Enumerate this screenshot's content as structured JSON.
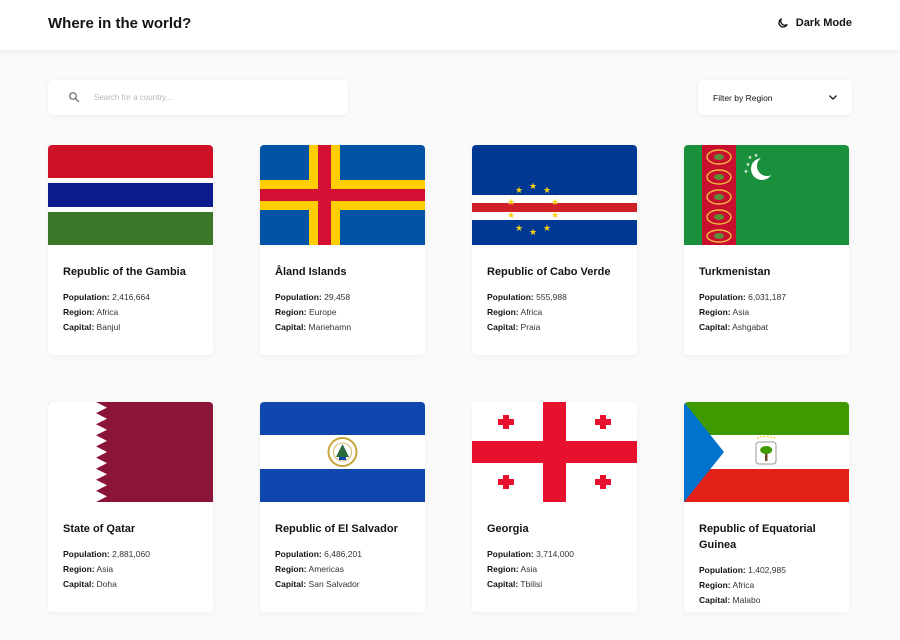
{
  "header": {
    "title": "Where in the world?",
    "theme_toggle_label": "Dark Mode"
  },
  "search": {
    "placeholder": "Search for a country...",
    "value": ""
  },
  "filter": {
    "label": "Filter by Region"
  },
  "field_labels": {
    "population": "Population:",
    "region": "Region:",
    "capital": "Capital:"
  },
  "countries": [
    {
      "name": "Republic of the Gambia",
      "population": "2,416,664",
      "region": "Africa",
      "capital": "Banjul"
    },
    {
      "name": "Åland Islands",
      "population": "29,458",
      "region": "Europe",
      "capital": "Mariehamn"
    },
    {
      "name": "Republic of Cabo Verde",
      "population": "555,988",
      "region": "Africa",
      "capital": "Praia"
    },
    {
      "name": "Turkmenistan",
      "population": "6,031,187",
      "region": "Asia",
      "capital": "Ashgabat"
    },
    {
      "name": "State of Qatar",
      "population": "2,881,060",
      "region": "Asia",
      "capital": "Doha"
    },
    {
      "name": "Republic of El Salvador",
      "population": "6,486,201",
      "region": "Americas",
      "capital": "San Salvador"
    },
    {
      "name": "Georgia",
      "population": "3,714,000",
      "region": "Asia",
      "capital": "Tbilisi"
    },
    {
      "name": "Republic of Equatorial Guinea",
      "population": "1,402,985",
      "region": "Africa",
      "capital": "Malabo"
    }
  ],
  "colors": {
    "background": "#fafafa",
    "surface": "#ffffff",
    "text": "#111517"
  }
}
